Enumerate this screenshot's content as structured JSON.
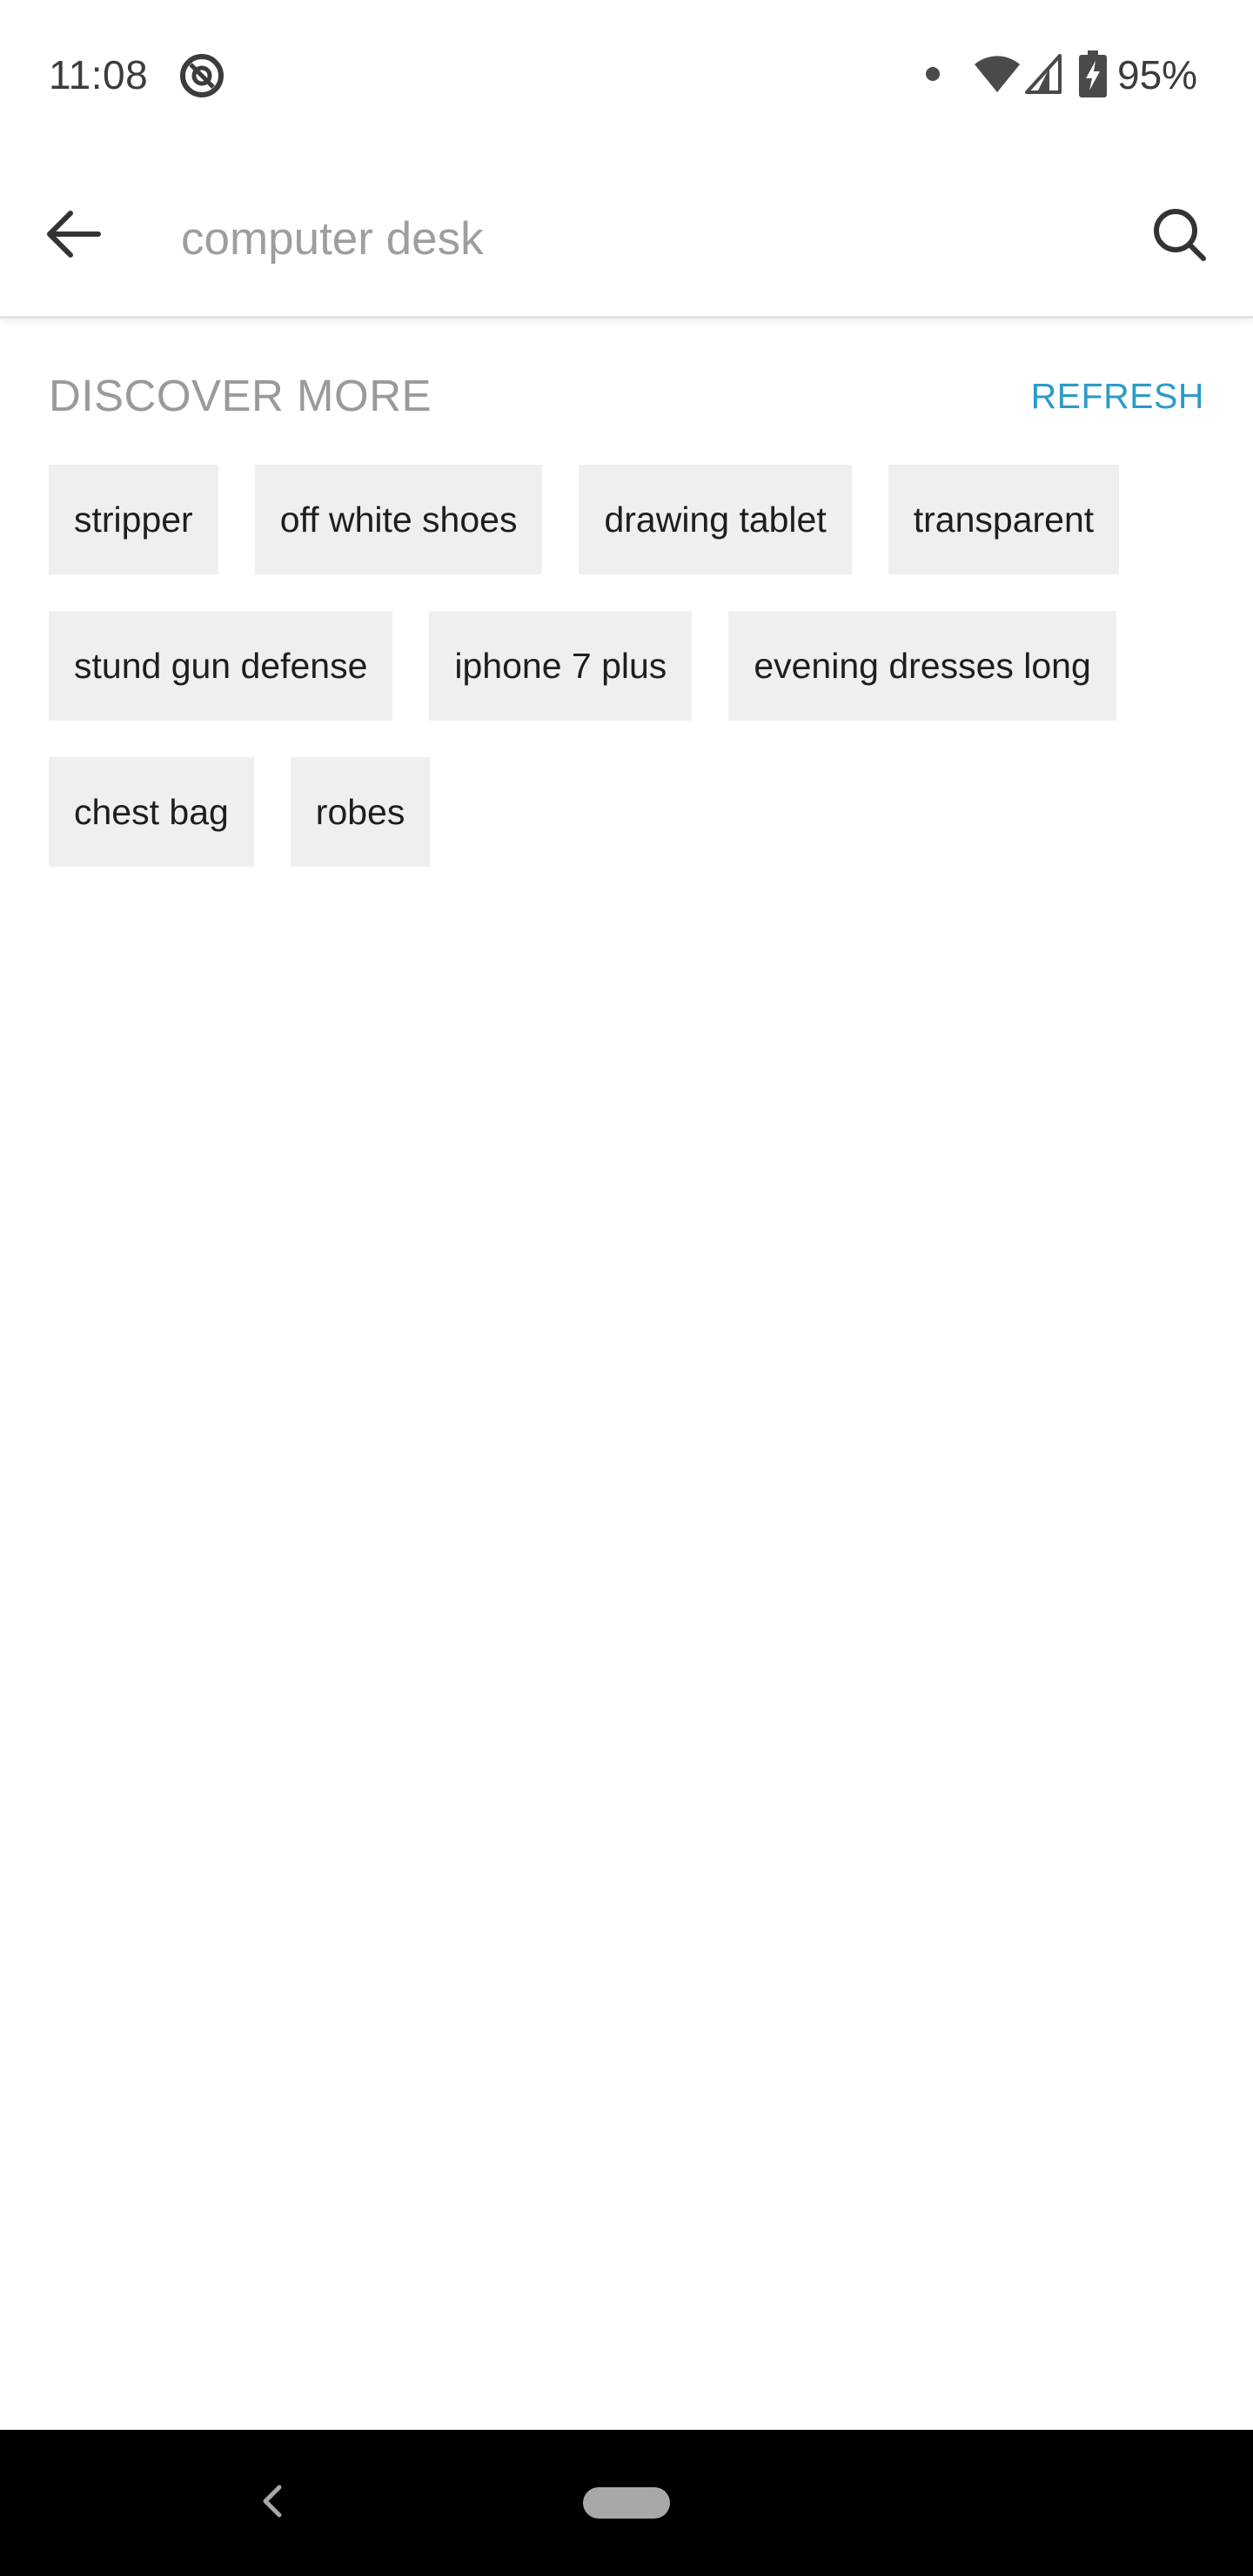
{
  "status_bar": {
    "time": "11:08",
    "battery_percent": "95%",
    "battery_charging": true
  },
  "search": {
    "placeholder": "computer desk",
    "value": ""
  },
  "discover": {
    "title": "DISCOVER MORE",
    "refresh_label": "REFRESH",
    "chip_rows": [
      [
        "stripper",
        "off white shoes",
        "drawing tablet",
        "transparent"
      ],
      [
        "stund gun defense",
        "iphone 7 plus",
        "evening dresses long"
      ],
      [
        "chest bag",
        "robes"
      ]
    ]
  },
  "colors": {
    "accent": "#2c9bc7",
    "chip_background": "#efefef",
    "section_title": "#9a9a9a",
    "nav_bar": "#000000"
  },
  "icons": {
    "status_app": "at-sign-badge-icon",
    "wifi": "wifi-icon",
    "signal": "cell-signal-icon",
    "battery": "battery-charging-icon",
    "back": "arrow-left-icon",
    "search": "search-icon",
    "nav_back": "chevron-left-icon",
    "nav_home": "home-pill-icon"
  }
}
